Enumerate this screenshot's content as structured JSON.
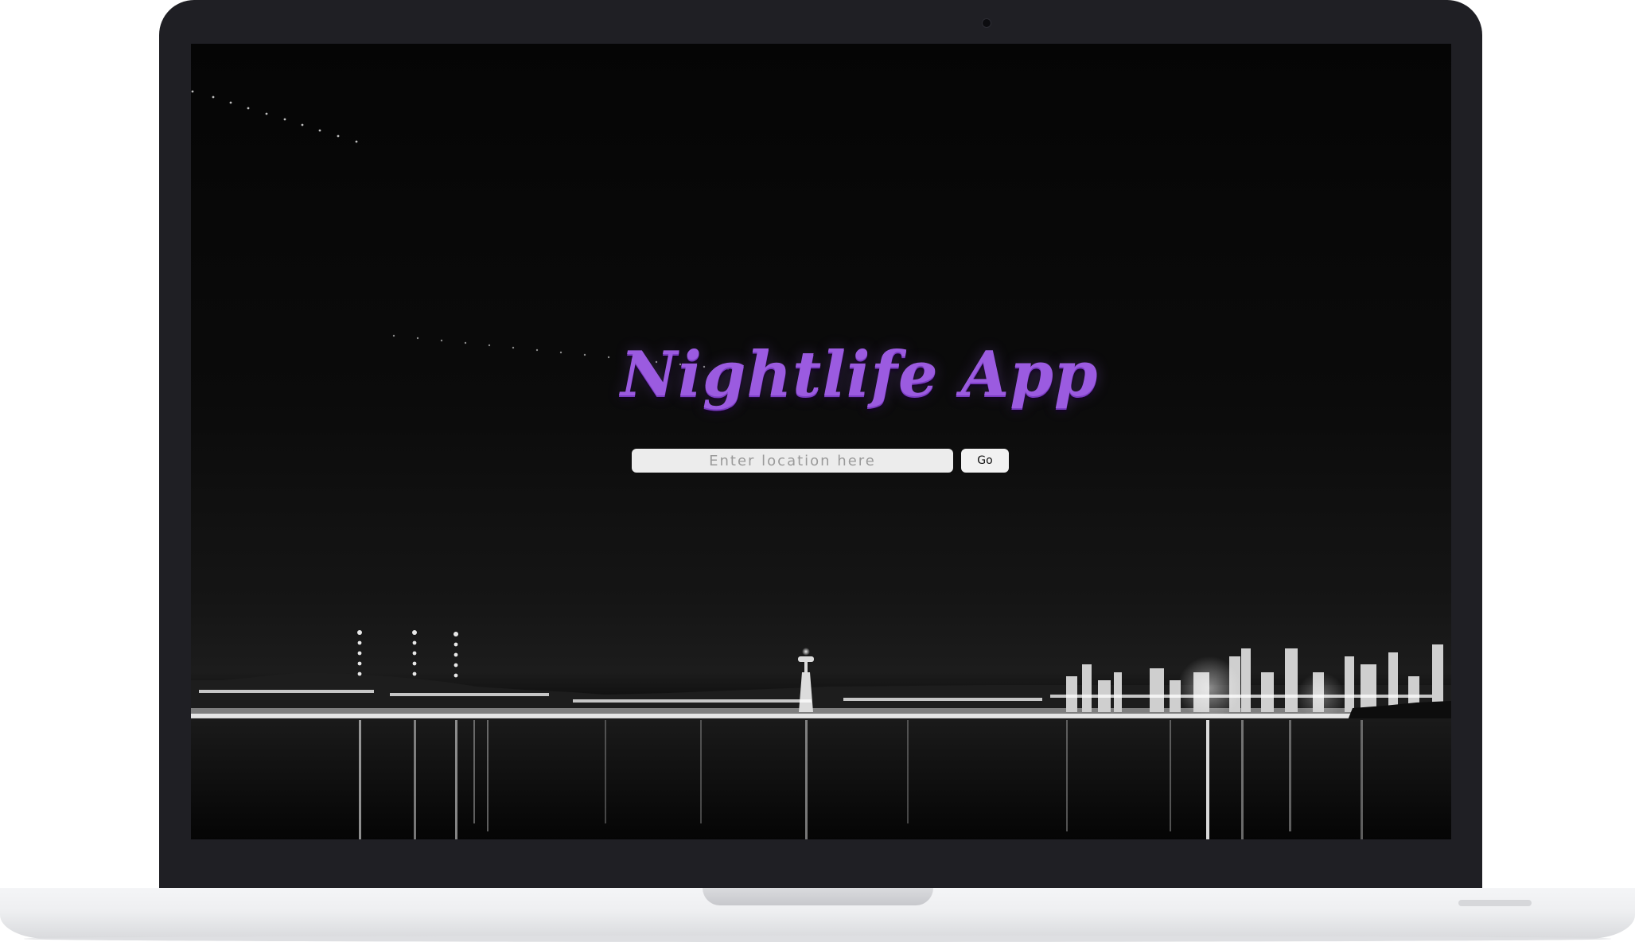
{
  "app": {
    "title": "Nightlife App"
  },
  "search": {
    "placeholder": "Enter location here",
    "value": "",
    "button_label": "Go"
  },
  "colors": {
    "title_accent": "#9b5be0",
    "device_frame": "#1f1f24",
    "device_base": "#eeeff1",
    "input_background": "#ececec"
  }
}
